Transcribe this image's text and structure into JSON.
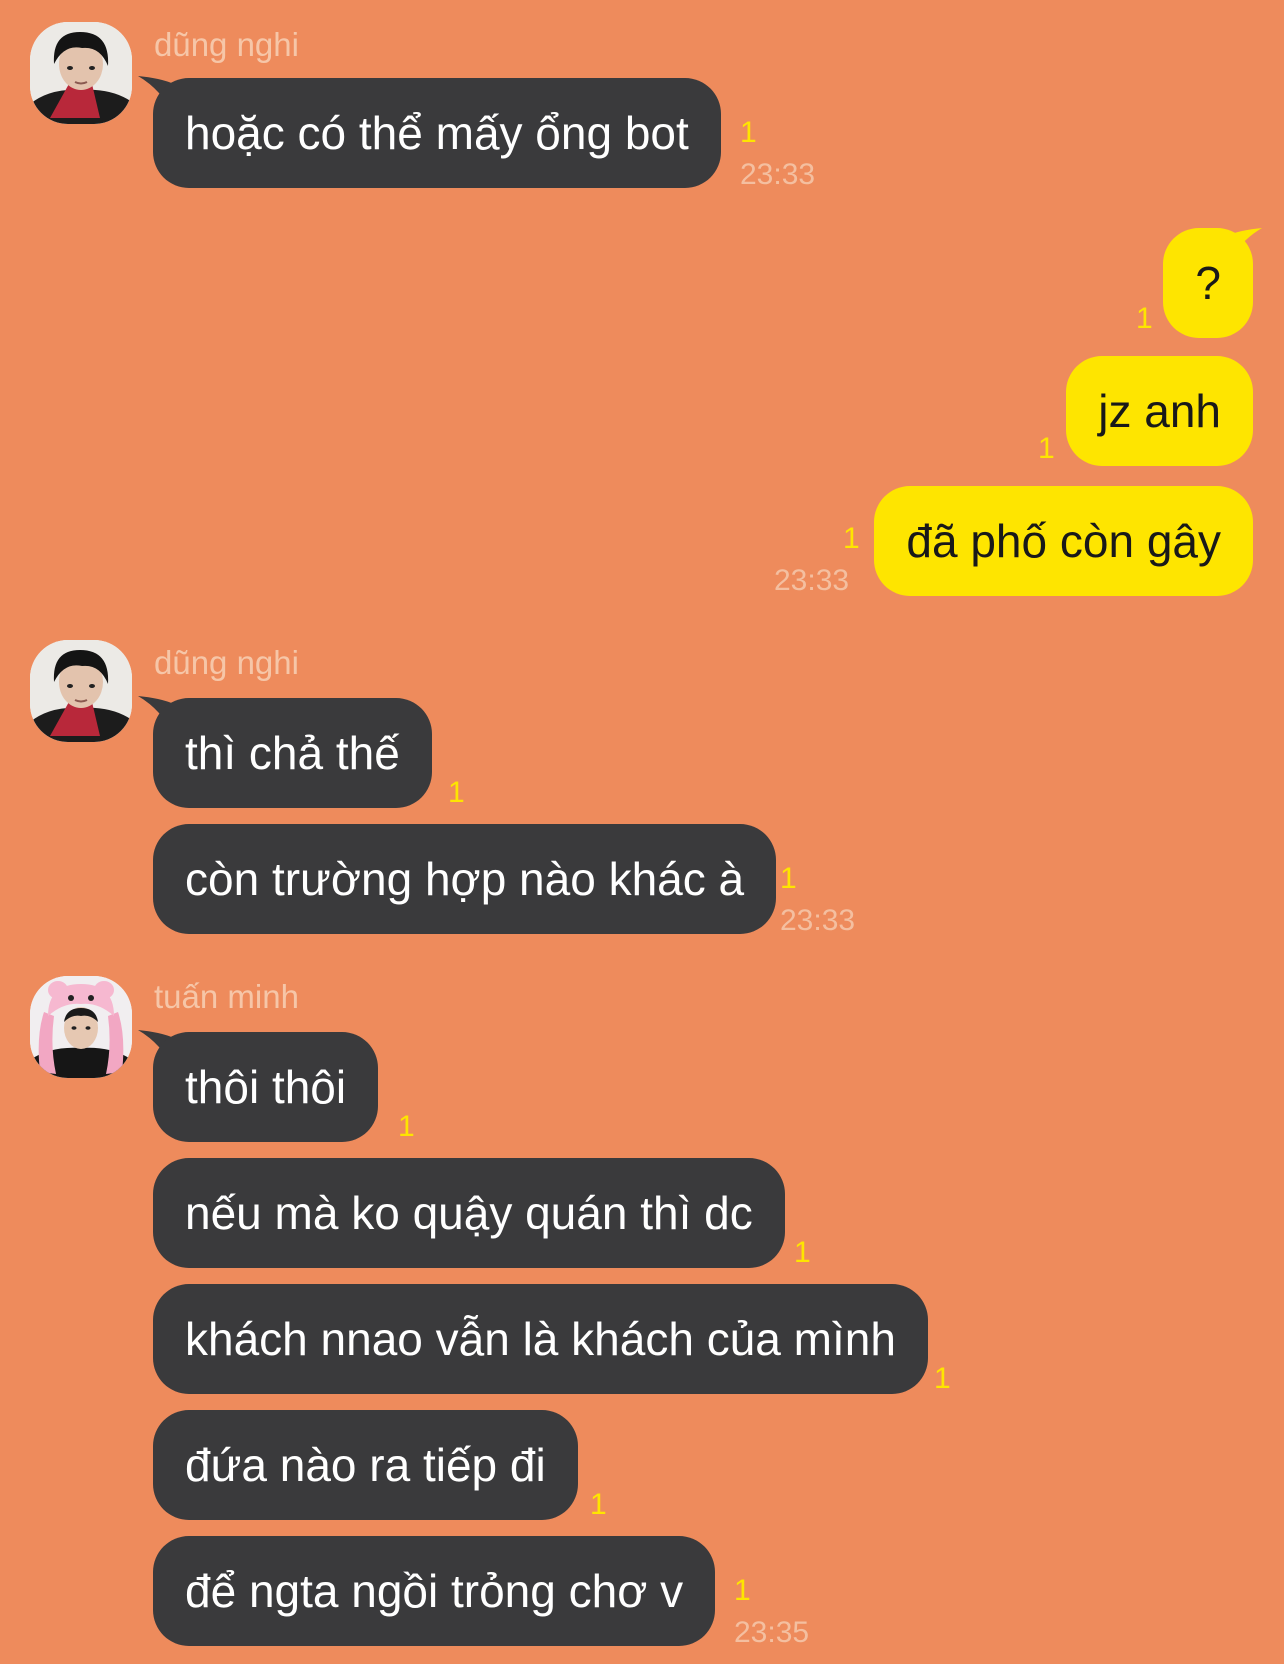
{
  "colors": {
    "background": "#EE8B5C",
    "incoming_bubble": "#3A3A3C",
    "outgoing_bubble": "#FEE500",
    "unread": "#FEE500",
    "meta_text": "#F6C6A8"
  },
  "messages": {
    "g1": {
      "sender": "dũng nghi",
      "m1": {
        "text": "hoặc có thể mấy ổng bot",
        "unread": "1",
        "time": "23:33"
      }
    },
    "g2": {
      "m1": {
        "text": "?",
        "unread": "1"
      },
      "m2": {
        "text": "jz anh",
        "unread": "1"
      },
      "m3": {
        "text": "đã phố còn gây",
        "unread": "1",
        "time": "23:33"
      }
    },
    "g3": {
      "sender": "dũng nghi",
      "m1": {
        "text": "thì chả thế",
        "unread": "1"
      },
      "m2": {
        "text": "còn trường hợp nào khác à",
        "unread": "1",
        "time": "23:33"
      }
    },
    "g4": {
      "sender": "tuấn minh",
      "m1": {
        "text": "thôi thôi",
        "unread": "1"
      },
      "m2": {
        "text": "nếu mà ko quậy quán thì dc",
        "unread": "1"
      },
      "m3": {
        "text": "khách nnao vẫn là khách của mình",
        "unread": "1"
      },
      "m4": {
        "text": "đứa nào ra tiếp đi",
        "unread": "1"
      },
      "m5": {
        "text": "để ngta ngồi trỏng chơ v",
        "unread": "1",
        "time": "23:35"
      }
    }
  }
}
